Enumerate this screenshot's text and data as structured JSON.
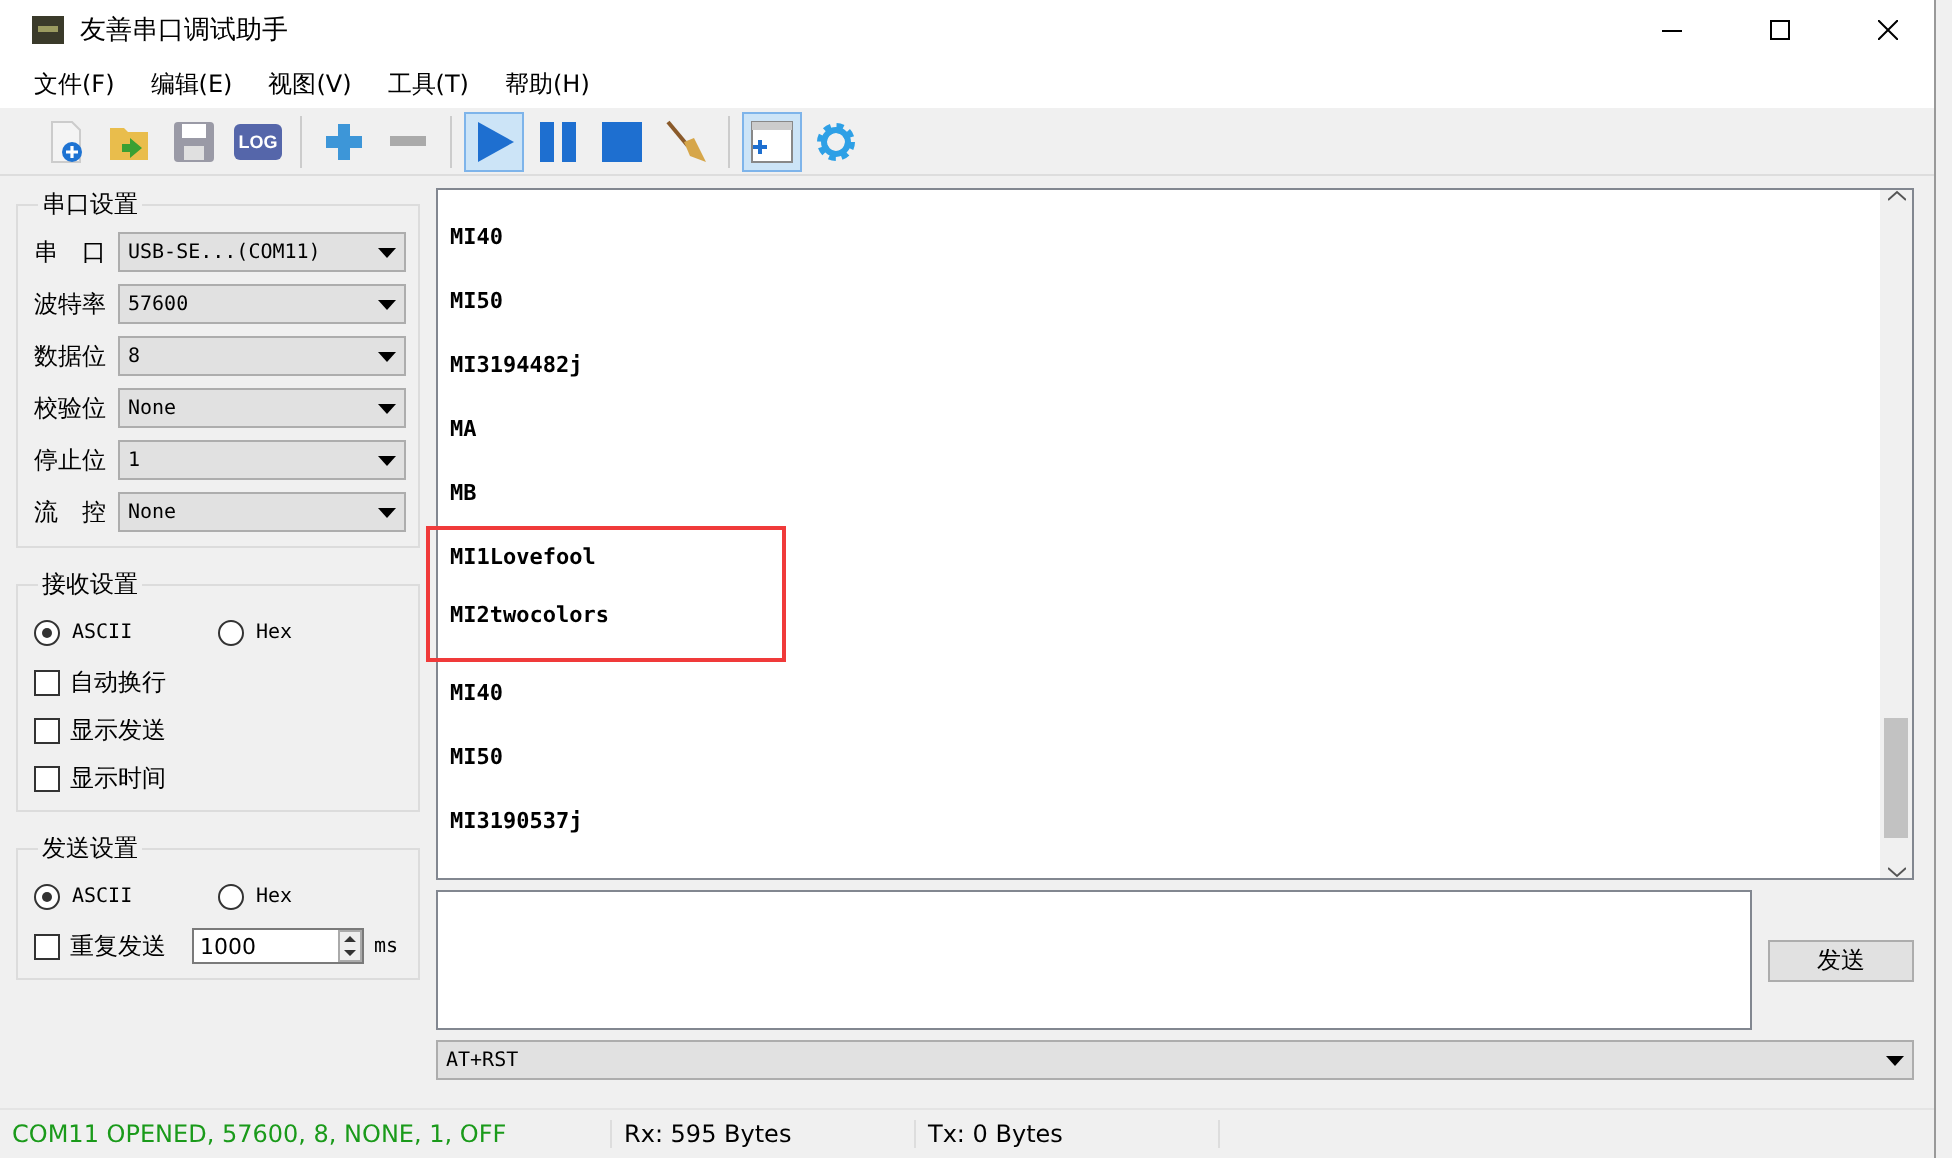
{
  "window": {
    "title": "友善串口调试助手"
  },
  "menu": [
    "文件(F)",
    "编辑(E)",
    "视图(V)",
    "工具(T)",
    "帮助(H)"
  ],
  "toolbar": [
    {
      "kind": "new",
      "selected": false
    },
    {
      "kind": "open",
      "selected": false
    },
    {
      "kind": "save",
      "selected": false
    },
    {
      "kind": "log",
      "label": "LOG",
      "selected": false
    },
    {
      "kind": "sep"
    },
    {
      "kind": "add",
      "selected": false
    },
    {
      "kind": "remove",
      "selected": false
    },
    {
      "kind": "sep"
    },
    {
      "kind": "play",
      "selected": true
    },
    {
      "kind": "pause",
      "selected": false
    },
    {
      "kind": "stop",
      "selected": false
    },
    {
      "kind": "broom",
      "selected": false
    },
    {
      "kind": "sep"
    },
    {
      "kind": "panel",
      "selected": true
    },
    {
      "kind": "gear",
      "selected": false
    }
  ],
  "serial_settings": {
    "title": "串口设置",
    "fields": [
      {
        "label": "串　口",
        "value": "USB-SE...(COM11)"
      },
      {
        "label": "波特率",
        "value": "57600"
      },
      {
        "label": "数据位",
        "value": "8"
      },
      {
        "label": "校验位",
        "value": "None"
      },
      {
        "label": "停止位",
        "value": "1"
      },
      {
        "label": "流　控",
        "value": "None"
      }
    ]
  },
  "receive_settings": {
    "title": "接收设置",
    "modes": [
      {
        "label": "ASCII",
        "selected": true
      },
      {
        "label": "Hex",
        "selected": false
      }
    ],
    "options": [
      {
        "label": "自动换行",
        "checked": false
      },
      {
        "label": "显示发送",
        "checked": false
      },
      {
        "label": "显示时间",
        "checked": false
      }
    ]
  },
  "send_settings": {
    "title": "发送设置",
    "modes": [
      {
        "label": "ASCII",
        "selected": true
      },
      {
        "label": "Hex",
        "selected": false
      }
    ],
    "repeat": {
      "label": "重复发送",
      "checked": false,
      "value": "1000",
      "unit": "ms"
    }
  },
  "receive_lines": [
    {
      "text": "MI40",
      "highlighted": false
    },
    {
      "text": "MI50",
      "highlighted": false
    },
    {
      "text": "MI3194482j",
      "highlighted": false
    },
    {
      "text": "MA",
      "highlighted": false
    },
    {
      "text": "MB",
      "highlighted": false
    },
    {
      "text": "MI1Lovefool",
      "highlighted": true
    },
    {
      "text": "MI2twocolors",
      "highlighted": true
    },
    {
      "text": "MI40",
      "highlighted": false
    },
    {
      "text": "MI50",
      "highlighted": false
    },
    {
      "text": "MI3190537j",
      "highlighted": false
    }
  ],
  "send_button": "发送",
  "command": "AT+RST",
  "status_bar": {
    "port": "COM11 OPENED, 57600, 8, NONE, 1, OFF",
    "rx": "Rx: 595 Bytes",
    "tx": "Tx: 0 Bytes"
  }
}
